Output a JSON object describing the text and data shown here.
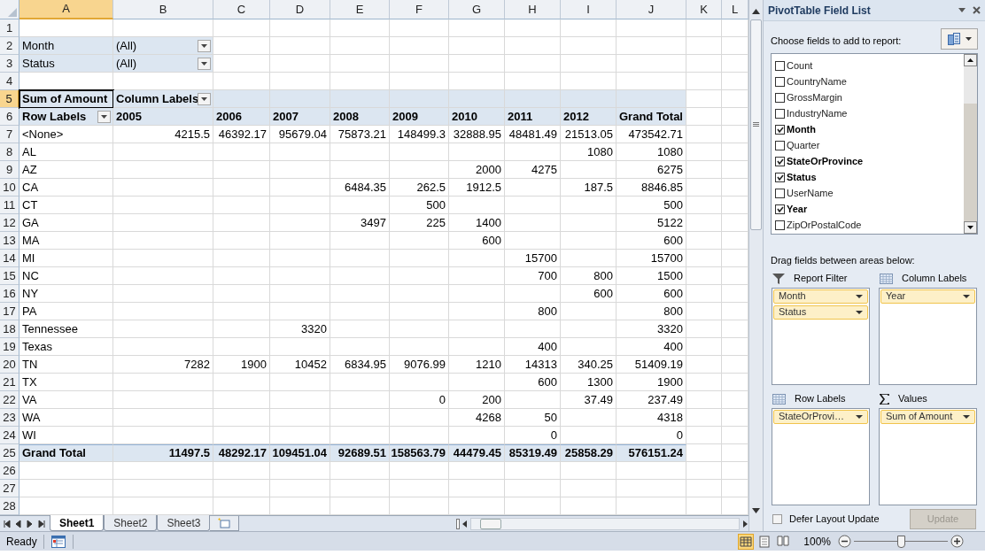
{
  "column_headers": [
    {
      "label": "A",
      "selected": true
    },
    {
      "label": "B",
      "selected": false
    },
    {
      "label": "C",
      "selected": false
    },
    {
      "label": "D",
      "selected": false
    },
    {
      "label": "E",
      "selected": false
    },
    {
      "label": "F",
      "selected": false
    },
    {
      "label": "G",
      "selected": false
    },
    {
      "label": "H",
      "selected": false
    },
    {
      "label": "I",
      "selected": false
    },
    {
      "label": "J",
      "selected": false
    },
    {
      "label": "K",
      "selected": false
    },
    {
      "label": "L",
      "selected": false
    }
  ],
  "rows": [
    {
      "number": "1",
      "selected": false,
      "kind": "blank"
    },
    {
      "number": "2",
      "selected": false,
      "kind": "filter",
      "cells": [
        "Month",
        {
          "text": "(All)",
          "dropdown": true
        }
      ]
    },
    {
      "number": "3",
      "selected": false,
      "kind": "filter",
      "cells": [
        "Status",
        {
          "text": "(All)",
          "dropdown": true
        }
      ]
    },
    {
      "number": "4",
      "selected": false,
      "kind": "blank"
    },
    {
      "number": "5",
      "selected": true,
      "kind": "header",
      "cells": [
        "Sum of Amount",
        {
          "text": "Column Labels",
          "dropdown": true
        }
      ]
    },
    {
      "number": "6",
      "selected": false,
      "kind": "header",
      "cells": [
        {
          "text": "Row Labels",
          "dropdown": true
        },
        "2005",
        "2006",
        "2007",
        "2008",
        "2009",
        "2010",
        "2011",
        "2012",
        "Grand Total"
      ]
    },
    {
      "number": "7",
      "selected": false,
      "kind": "data",
      "cells": [
        "<None>",
        "4215.5",
        "46392.17",
        "95679.04",
        "75873.21",
        "148499.3",
        "32888.95",
        "48481.49",
        "21513.05",
        "473542.71"
      ]
    },
    {
      "number": "8",
      "selected": false,
      "kind": "data",
      "cells": [
        "AL",
        null,
        null,
        null,
        null,
        null,
        null,
        null,
        "1080",
        "1080"
      ]
    },
    {
      "number": "9",
      "selected": false,
      "kind": "data",
      "cells": [
        "AZ",
        null,
        null,
        null,
        null,
        null,
        "2000",
        "4275",
        null,
        "6275"
      ]
    },
    {
      "number": "10",
      "selected": false,
      "kind": "data",
      "cells": [
        "CA",
        null,
        null,
        null,
        "6484.35",
        "262.5",
        "1912.5",
        null,
        "187.5",
        "8846.85"
      ]
    },
    {
      "number": "11",
      "selected": false,
      "kind": "data",
      "cells": [
        "CT",
        null,
        null,
        null,
        null,
        "500",
        null,
        null,
        null,
        "500"
      ]
    },
    {
      "number": "12",
      "selected": false,
      "kind": "data",
      "cells": [
        "GA",
        null,
        null,
        null,
        "3497",
        "225",
        "1400",
        null,
        null,
        "5122"
      ]
    },
    {
      "number": "13",
      "selected": false,
      "kind": "data",
      "cells": [
        "MA",
        null,
        null,
        null,
        null,
        null,
        "600",
        null,
        null,
        "600"
      ]
    },
    {
      "number": "14",
      "selected": false,
      "kind": "data",
      "cells": [
        "MI",
        null,
        null,
        null,
        null,
        null,
        null,
        "15700",
        null,
        "15700"
      ]
    },
    {
      "number": "15",
      "selected": false,
      "kind": "data",
      "cells": [
        "NC",
        null,
        null,
        null,
        null,
        null,
        null,
        "700",
        "800",
        "1500"
      ]
    },
    {
      "number": "16",
      "selected": false,
      "kind": "data",
      "cells": [
        "NY",
        null,
        null,
        null,
        null,
        null,
        null,
        null,
        "600",
        "600"
      ]
    },
    {
      "number": "17",
      "selected": false,
      "kind": "data",
      "cells": [
        "PA",
        null,
        null,
        null,
        null,
        null,
        null,
        "800",
        null,
        "800"
      ]
    },
    {
      "number": "18",
      "selected": false,
      "kind": "data",
      "cells": [
        "Tennessee",
        null,
        null,
        "3320",
        null,
        null,
        null,
        null,
        null,
        "3320"
      ]
    },
    {
      "number": "19",
      "selected": false,
      "kind": "data",
      "cells": [
        "Texas",
        null,
        null,
        null,
        null,
        null,
        null,
        "400",
        null,
        "400"
      ]
    },
    {
      "number": "20",
      "selected": false,
      "kind": "data",
      "cells": [
        "TN",
        "7282",
        "1900",
        "10452",
        "6834.95",
        "9076.99",
        "1210",
        "14313",
        "340.25",
        "51409.19"
      ]
    },
    {
      "number": "21",
      "selected": false,
      "kind": "data",
      "cells": [
        "TX",
        null,
        null,
        null,
        null,
        null,
        null,
        "600",
        "1300",
        "1900"
      ]
    },
    {
      "number": "22",
      "selected": false,
      "kind": "data",
      "cells": [
        "VA",
        null,
        null,
        null,
        null,
        "0",
        "200",
        null,
        "37.49",
        "237.49"
      ]
    },
    {
      "number": "23",
      "selected": false,
      "kind": "data",
      "cells": [
        "WA",
        null,
        null,
        null,
        null,
        null,
        "4268",
        "50",
        null,
        "4318"
      ]
    },
    {
      "number": "24",
      "selected": false,
      "kind": "data",
      "cells": [
        "WI",
        null,
        null,
        null,
        null,
        null,
        null,
        "0",
        null,
        "0"
      ]
    },
    {
      "number": "25",
      "selected": false,
      "kind": "total",
      "cells": [
        "Grand Total",
        "11497.5",
        "48292.17",
        "109451.04",
        "92689.51",
        "158563.79",
        "44479.45",
        "85319.49",
        "25858.29",
        "576151.24"
      ]
    },
    {
      "number": "26",
      "selected": false,
      "kind": "blank"
    },
    {
      "number": "27",
      "selected": false,
      "kind": "blank"
    },
    {
      "number": "28",
      "selected": false,
      "kind": "blank"
    }
  ],
  "sheet_tabs": [
    {
      "label": "Sheet1",
      "selected": true
    },
    {
      "label": "Sheet2",
      "selected": false
    },
    {
      "label": "Sheet3",
      "selected": false
    }
  ],
  "field_list": {
    "title": "PivotTable Field List",
    "prompt": "Choose fields to add to report:",
    "fields": [
      {
        "label": "Count",
        "checked": false
      },
      {
        "label": "CountryName",
        "checked": false
      },
      {
        "label": "GrossMargin",
        "checked": false
      },
      {
        "label": "IndustryName",
        "checked": false
      },
      {
        "label": "Month",
        "checked": true
      },
      {
        "label": "Quarter",
        "checked": false
      },
      {
        "label": "StateOrProvince",
        "checked": true
      },
      {
        "label": "Status",
        "checked": true
      },
      {
        "label": "UserName",
        "checked": false
      },
      {
        "label": "Year",
        "checked": true
      },
      {
        "label": "ZipOrPostalCode",
        "checked": false
      }
    ],
    "areas_prompt": "Drag fields between areas below:",
    "areas": [
      {
        "label": "Report Filter",
        "kind": "filter",
        "fields": [
          "Month",
          "Status"
        ]
      },
      {
        "label": "Column Labels",
        "kind": "grid",
        "fields": [
          "Year"
        ]
      },
      {
        "label": "Row Labels",
        "kind": "grid",
        "fields": [
          "StateOrProvi…"
        ]
      },
      {
        "label": "Values",
        "kind": "sigma",
        "fields": [
          "Sum of Amount"
        ]
      }
    ],
    "defer": {
      "label": "Defer Layout Update",
      "checked": false
    },
    "update_button": {
      "label": "Update",
      "disabled": true
    }
  },
  "status_bar": {
    "text": "Ready",
    "views": [
      {
        "kind": "normal",
        "selected": true
      },
      {
        "kind": "page_layout",
        "selected": false
      },
      {
        "kind": "page_break",
        "selected": false
      }
    ],
    "zoom": "100%",
    "zoom_slider": {
      "level": 0.5
    }
  }
}
